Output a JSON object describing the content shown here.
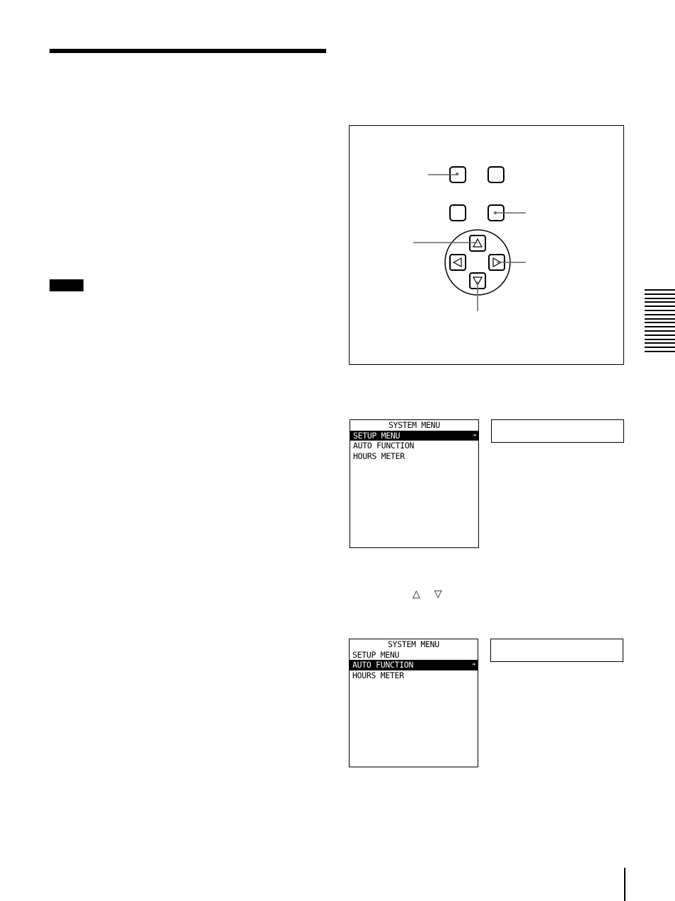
{
  "document": {
    "section_tab_lines": 16
  },
  "diagram": {
    "icons": {
      "up": "△",
      "down": "▽",
      "left": "◁",
      "right": "▷"
    }
  },
  "screens": [
    {
      "title": "SYSTEM MENU",
      "items": [
        "SETUP MENU",
        "AUTO FUNCTION",
        "HOURS METER"
      ],
      "selected_index": 0,
      "selected_marker": "➔"
    },
    {
      "title": "SYSTEM MENU",
      "items": [
        "SETUP MENU",
        "AUTO FUNCTION",
        "HOURS METER"
      ],
      "selected_index": 1,
      "selected_marker": "➔"
    }
  ],
  "inline_arrows": {
    "up": "△",
    "down": "▽"
  }
}
